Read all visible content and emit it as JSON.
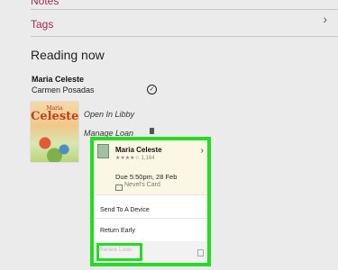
{
  "previous_row": {
    "label": "Notes"
  },
  "tags": {
    "label": "Tags"
  },
  "section": {
    "title": "Reading now"
  },
  "book": {
    "title": "Maria Celeste",
    "author": "Carmen Posadas",
    "cover_title_small": "Maria",
    "cover_title_large": "Celeste"
  },
  "actions": {
    "open_in_libby": "Open In Libby",
    "manage_loan": "Manage Loan"
  },
  "menu": {
    "title": "Maria Celeste",
    "rating_text": "★★★★☆ 1,164",
    "due": "Due 5:50pm, 28 Feb",
    "card": "Nevel's Card",
    "items": [
      "Send To A Device",
      "Return Early"
    ],
    "renew_label": "Renew Loan"
  },
  "colors": {
    "accent": "#a02a55",
    "highlight": "#22dd22"
  }
}
